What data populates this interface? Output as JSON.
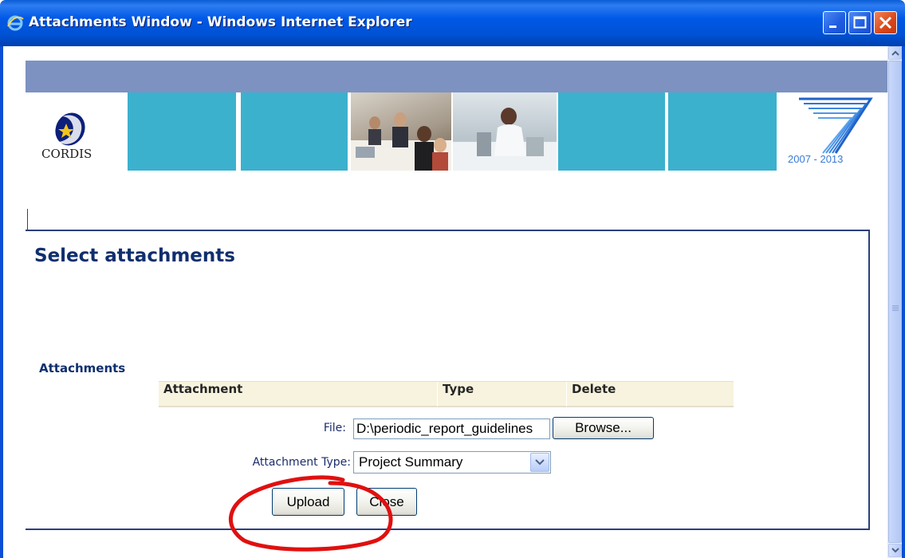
{
  "window": {
    "title": "Attachments Window - Windows Internet Explorer",
    "icon": "ie-icon",
    "controls": [
      "minimize-icon",
      "maximize-icon",
      "close-icon"
    ]
  },
  "banner": {
    "left_logo_text": "CORDIS",
    "right_logo_text": "2007 - 2013"
  },
  "page": {
    "title": "Select attachments",
    "section_label": "Attachments"
  },
  "table": {
    "columns": [
      "Attachment",
      "Type",
      "Delete"
    ]
  },
  "form": {
    "file_label": "File:",
    "file_value": "D:\\periodic_report_guidelines",
    "browse_label": "Browse...",
    "type_label": "Attachment Type:",
    "type_selected": "Project Summary",
    "upload_label": "Upload",
    "close_label": "Close"
  },
  "colors": {
    "titlebar": "#0052d4",
    "header_bar": "#7d92c1",
    "banner_blocks": "#3bb1ce",
    "heading_text": "#0f2f6e",
    "table_header_bg": "#f8f3de",
    "annotation": "#e01010"
  }
}
